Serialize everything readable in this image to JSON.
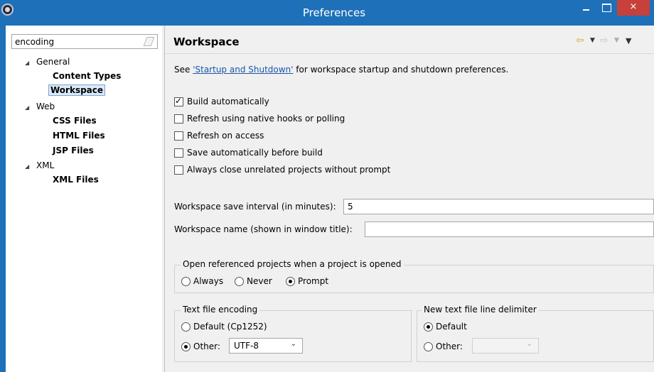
{
  "window": {
    "title": "Preferences",
    "minimize_label": "",
    "maximize_label": "",
    "close_label": "×"
  },
  "filter": {
    "value": "encoding"
  },
  "tree": {
    "general": {
      "label": "General",
      "children": [
        "Content Types",
        "Workspace"
      ]
    },
    "web": {
      "label": "Web",
      "children": [
        "CSS Files",
        "HTML Files",
        "JSP Files"
      ]
    },
    "xml": {
      "label": "XML",
      "children": [
        "XML Files"
      ]
    },
    "selected": "Workspace"
  },
  "page": {
    "title": "Workspace",
    "intro_prefix": "See ",
    "intro_link": "'Startup and Shutdown'",
    "intro_suffix": " for workspace startup and shutdown preferences."
  },
  "options": [
    {
      "label": "Build automatically",
      "checked": true
    },
    {
      "label": "Refresh using native hooks or polling",
      "checked": false
    },
    {
      "label": "Refresh on access",
      "checked": false
    },
    {
      "label": "Save automatically before build",
      "checked": false
    },
    {
      "label": "Always close unrelated projects without prompt",
      "checked": false
    }
  ],
  "save_interval": {
    "label": "Workspace save interval (in minutes):",
    "value": "5"
  },
  "workspace_name": {
    "label": "Workspace name (shown in window title):",
    "value": ""
  },
  "open_projects": {
    "legend": "Open referenced projects when a project is opened",
    "choices": [
      "Always",
      "Never",
      "Prompt"
    ],
    "selected": "Prompt"
  },
  "encoding": {
    "legend": "Text file encoding",
    "default_label": "Default (Cp1252)",
    "other_label": "Other:",
    "selected": "Other",
    "other_value": "UTF-8"
  },
  "line_delimiter": {
    "legend": "New text file line delimiter",
    "default_label": "Default",
    "other_label": "Other:",
    "selected": "Default",
    "other_value": ""
  },
  "colors": {
    "titlebar": "#1e71b8",
    "close_button": "#c7403a",
    "link": "#1a56a8",
    "nav_back": "#e0a82e"
  }
}
